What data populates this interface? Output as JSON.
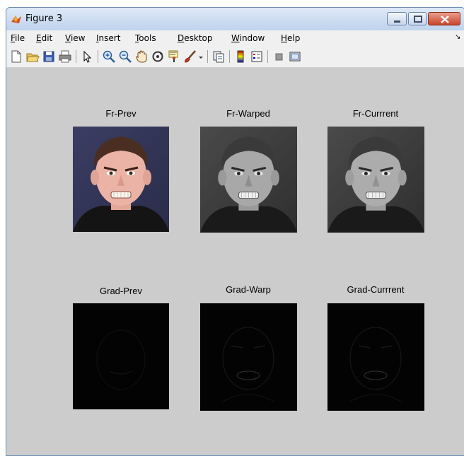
{
  "window": {
    "title": "Figure 3"
  },
  "menu": {
    "items": [
      {
        "label": "File",
        "u": "F",
        "rest": "ile"
      },
      {
        "label": "Edit",
        "u": "E",
        "rest": "dit"
      },
      {
        "label": "View",
        "u": "V",
        "rest": "iew"
      },
      {
        "label": "Insert",
        "u": "I",
        "rest": "nsert"
      },
      {
        "label": "Tools",
        "u": "T",
        "rest": "ools"
      },
      {
        "label": "Desktop",
        "u": "D",
        "rest": "esktop"
      },
      {
        "label": "Window",
        "u": "W",
        "rest": "indow"
      },
      {
        "label": "Help",
        "u": "H",
        "rest": "elp"
      }
    ]
  },
  "toolbar": {
    "icons": [
      "new-figure-icon",
      "open-file-icon",
      "save-icon",
      "print-icon",
      "pointer-icon",
      "zoom-in-icon",
      "zoom-out-icon",
      "pan-icon",
      "rotate-3d-icon",
      "data-cursor-icon",
      "brush-icon",
      "link-plot-icon",
      "colorbar-icon",
      "legend-icon",
      "hide-plot-tools-icon",
      "show-plot-tools-icon"
    ]
  },
  "axes": [
    {
      "title": "Fr-Prev"
    },
    {
      "title": "Fr-Warped"
    },
    {
      "title": "Fr-Currrent"
    },
    {
      "title": "Grad-Prev"
    },
    {
      "title": "Grad-Warp"
    },
    {
      "title": "Grad-Currrent"
    }
  ]
}
